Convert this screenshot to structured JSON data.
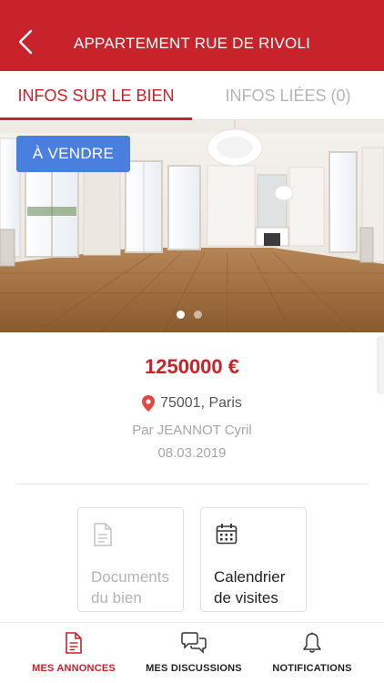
{
  "header": {
    "title": "APPARTEMENT RUE DE RIVOLI",
    "back_icon": "chevron-left-icon"
  },
  "tabs": [
    {
      "label": "INFOS SUR LE BIEN",
      "active": true
    },
    {
      "label": "INFOS LIÉES (0)",
      "active": false
    }
  ],
  "gallery": {
    "badge": "À VENDRE",
    "image_count": 2,
    "current_index": 1
  },
  "listing": {
    "price": "1250000 €",
    "location": "75001, Paris",
    "author": "Par JEANNOT Cyril",
    "date": "08.03.2019"
  },
  "cards": [
    {
      "line1": "Documents",
      "line2": "du bien",
      "icon": "document-icon",
      "enabled": false
    },
    {
      "line1": "Calendrier",
      "line2": "de visites",
      "icon": "calendar-icon",
      "enabled": true
    }
  ],
  "bottom_nav": [
    {
      "label": "MES ANNONCES",
      "icon": "document-icon",
      "active": true
    },
    {
      "label": "MES DISCUSSIONS",
      "icon": "chat-icon",
      "active": false
    },
    {
      "label": "NOTIFICATIONS",
      "icon": "bell-icon",
      "active": false
    }
  ],
  "colors": {
    "brand": "#c8222a",
    "badge": "#4a7fe0",
    "muted": "#a6a6a6"
  }
}
